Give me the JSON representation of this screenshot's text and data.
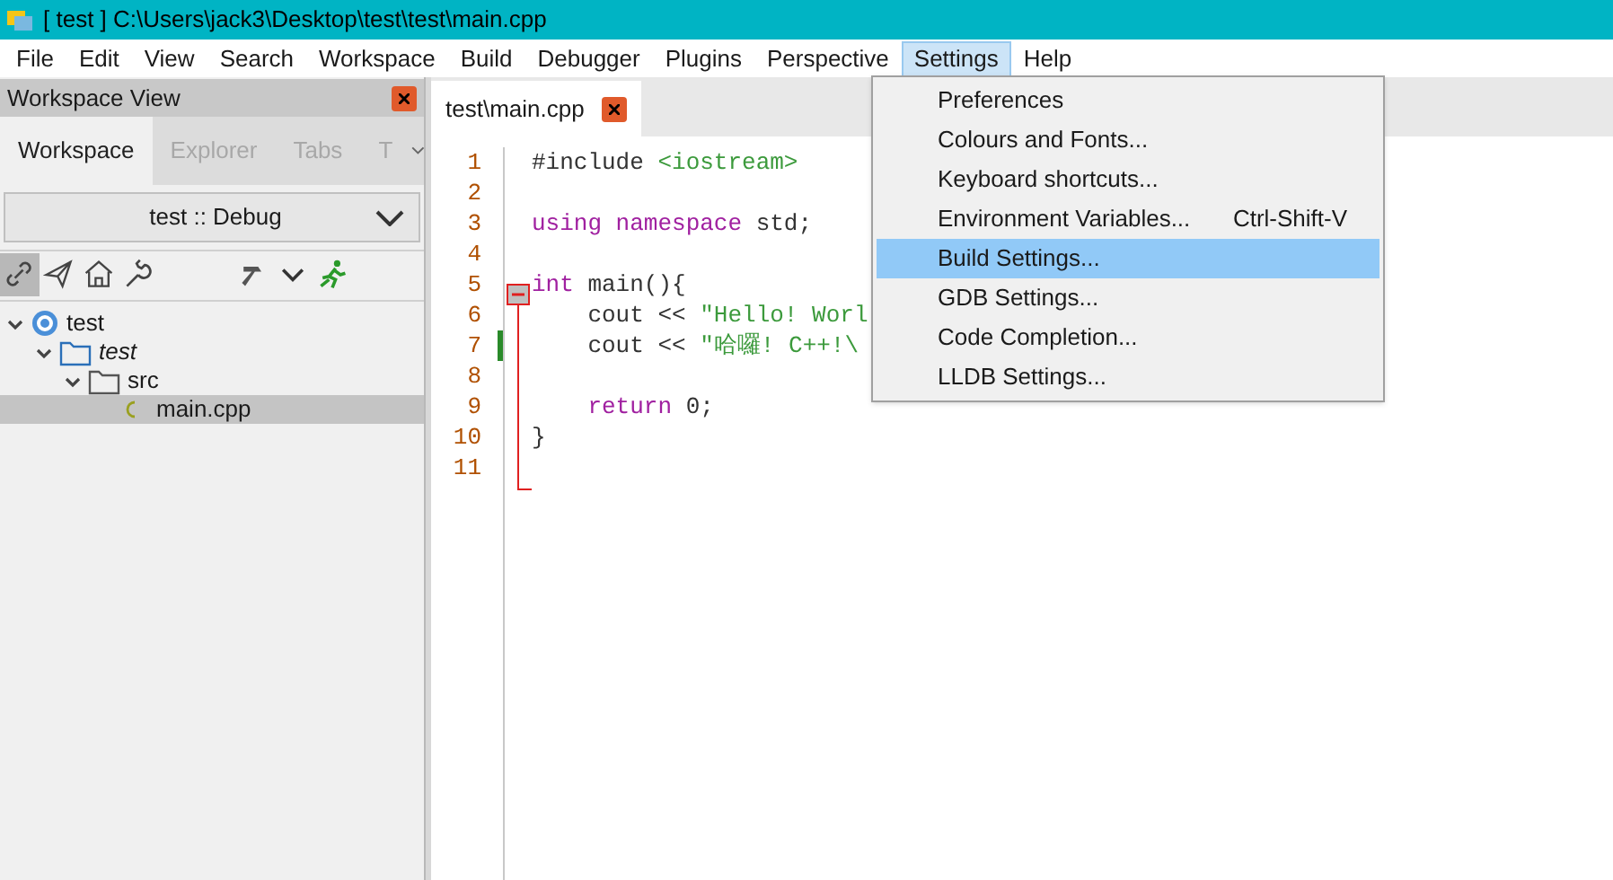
{
  "window": {
    "title": "[ test ] C:\\Users\\jack3\\Desktop\\test\\test\\main.cpp"
  },
  "menu_bar": [
    {
      "label": "File",
      "selected": false
    },
    {
      "label": "Edit",
      "selected": false
    },
    {
      "label": "View",
      "selected": false
    },
    {
      "label": "Search",
      "selected": false
    },
    {
      "label": "Workspace",
      "selected": false
    },
    {
      "label": "Build",
      "selected": false
    },
    {
      "label": "Debugger",
      "selected": false
    },
    {
      "label": "Plugins",
      "selected": false
    },
    {
      "label": "Perspective",
      "selected": false
    },
    {
      "label": "Settings",
      "selected": true
    },
    {
      "label": "Help",
      "selected": false
    }
  ],
  "workspace_panel": {
    "title": "Workspace View",
    "tabs": [
      {
        "label": "Workspace",
        "selected": true
      },
      {
        "label": "Explorer",
        "selected": false
      },
      {
        "label": "Tabs",
        "selected": false
      },
      {
        "label": "T",
        "selected": false
      }
    ],
    "configuration": "test :: Debug",
    "toolbar": [
      {
        "kind": "link",
        "selected": true
      },
      {
        "kind": "send",
        "selected": false
      },
      {
        "kind": "home",
        "selected": false
      },
      {
        "kind": "wrench",
        "selected": false
      },
      {
        "kind": "hammer",
        "selected": false
      },
      {
        "kind": "chevron",
        "selected": false
      },
      {
        "kind": "run",
        "selected": false
      }
    ],
    "tree": [
      {
        "label": "test",
        "kind": "project",
        "italic": false,
        "selected": false,
        "expanded": true,
        "children": [
          {
            "label": "test",
            "kind": "folder",
            "italic": true,
            "selected": false,
            "expanded": true,
            "children": [
              {
                "label": "src",
                "kind": "folder",
                "italic": false,
                "selected": false,
                "expanded": true,
                "children": [
                  {
                    "label": "main.cpp",
                    "kind": "file",
                    "italic": false,
                    "selected": true
                  }
                ]
              }
            ]
          }
        ]
      }
    ]
  },
  "editor": {
    "tabs": [
      {
        "label": "test\\main.cpp",
        "selected": true
      }
    ],
    "lines": [
      {
        "number": "1",
        "modified": false,
        "tokens": [
          {
            "kind": "plain",
            "text": "#include "
          },
          {
            "kind": "string",
            "text": "<iostream>"
          }
        ]
      },
      {
        "number": "2",
        "modified": false
      },
      {
        "number": "3",
        "modified": false,
        "tokens": [
          {
            "kind": "keyword",
            "text": "using namespace"
          },
          {
            "kind": "plain",
            "text": " std;"
          }
        ]
      },
      {
        "number": "4",
        "modified": false
      },
      {
        "number": "5",
        "modified": false,
        "fold_start": true,
        "tokens": [
          {
            "kind": "keyword",
            "text": "int"
          },
          {
            "kind": "plain",
            "text": " main(){"
          }
        ]
      },
      {
        "number": "6",
        "modified": false,
        "tokens": [
          {
            "kind": "plain",
            "text": "    cout << "
          },
          {
            "kind": "string",
            "text": "\"Hello! Worl"
          }
        ]
      },
      {
        "number": "7",
        "modified": true,
        "tokens": [
          {
            "kind": "plain",
            "text": "    cout << "
          },
          {
            "kind": "string",
            "text": "\"哈囉! C++!\\"
          }
        ]
      },
      {
        "number": "8",
        "modified": false
      },
      {
        "number": "9",
        "modified": false,
        "tokens": [
          {
            "kind": "keyword",
            "text": "    return"
          },
          {
            "kind": "plain",
            "text": " 0;"
          }
        ]
      },
      {
        "number": "10",
        "modified": false,
        "tokens": [
          {
            "kind": "plain",
            "text": "}"
          }
        ]
      },
      {
        "number": "11",
        "modified": false
      }
    ]
  },
  "settings_menu": [
    {
      "label": "Preferences",
      "selected": false
    },
    {
      "label": "Colours and Fonts...",
      "selected": false
    },
    {
      "label": "Keyboard shortcuts...",
      "selected": false
    },
    {
      "label": "Environment Variables...",
      "shortcut": "Ctrl-Shift-V",
      "selected": false
    },
    {
      "label": "Build Settings...",
      "selected": true
    },
    {
      "label": "GDB Settings...",
      "selected": false
    },
    {
      "label": "Code Completion...",
      "selected": false
    },
    {
      "label": "LLDB Settings...",
      "selected": false
    }
  ]
}
